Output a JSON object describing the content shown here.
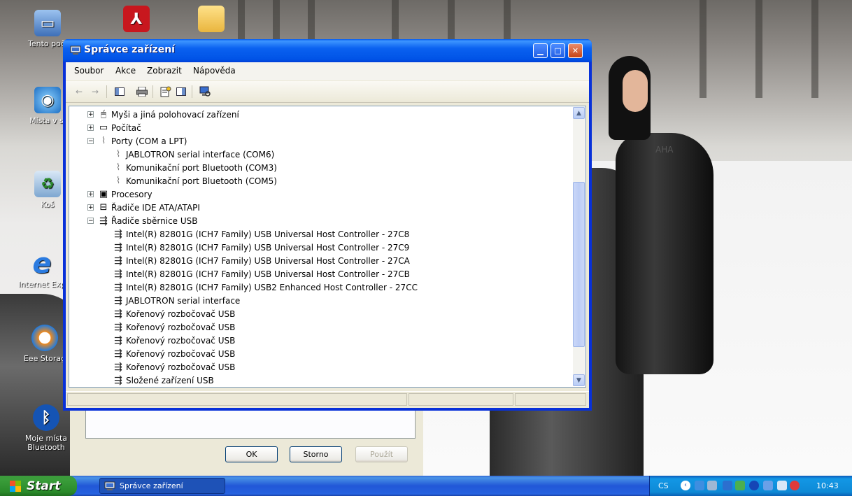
{
  "desktop": {
    "icons": [
      {
        "label": "Tento počí",
        "icon": "my-computer-icon"
      },
      {
        "label": "Místa v sí",
        "icon": "network-places-icon"
      },
      {
        "label": "Koš",
        "icon": "recycle-bin-icon"
      },
      {
        "label": "Internet Exp",
        "icon": "internet-explorer-icon"
      },
      {
        "label": "Eee Storag",
        "icon": "eee-storage-icon"
      },
      {
        "label": "Moje místa Bluetooth",
        "icon": "bluetooth-icon"
      },
      {
        "label": "",
        "icon": "adobe-reader-icon"
      },
      {
        "label": "",
        "icon": "folder-icon"
      }
    ],
    "wall_text": "AHA"
  },
  "back_dialog": {
    "ok_label": "OK",
    "cancel_label": "Storno",
    "apply_label": "Použít"
  },
  "window": {
    "title": "Správce zařízení",
    "menu": [
      "Soubor",
      "Akce",
      "Zobrazit",
      "Nápověda"
    ],
    "toolbar": [
      "back-icon",
      "forward-icon",
      "console-tree-icon",
      "print-icon",
      "properties-icon",
      "help-icon",
      "scan-hardware-icon"
    ],
    "tree": [
      {
        "label": "Myši a jiná polohovací zařízení",
        "level": 0,
        "expander": "+",
        "icon": "mouse-icon"
      },
      {
        "label": "Počítač",
        "level": 0,
        "expander": "+",
        "icon": "computer-icon"
      },
      {
        "label": "Porty (COM a LPT)",
        "level": 0,
        "expander": "−",
        "icon": "port-icon"
      },
      {
        "label": "JABLOTRON serial interface (COM6)",
        "level": 1,
        "expander": "",
        "icon": "port-icon"
      },
      {
        "label": "Komunikační port Bluetooth (COM3)",
        "level": 1,
        "expander": "",
        "icon": "port-icon"
      },
      {
        "label": "Komunikační port Bluetooth (COM5)",
        "level": 1,
        "expander": "",
        "icon": "port-icon"
      },
      {
        "label": "Procesory",
        "level": 0,
        "expander": "+",
        "icon": "processor-icon"
      },
      {
        "label": "Řadiče IDE ATA/ATAPI",
        "level": 0,
        "expander": "+",
        "icon": "ide-controller-icon"
      },
      {
        "label": "Řadiče sběrnice USB",
        "level": 0,
        "expander": "−",
        "icon": "usb-icon"
      },
      {
        "label": "Intel(R) 82801G (ICH7 Family) USB Universal Host Controller - 27C8",
        "level": 1,
        "expander": "",
        "icon": "usb-icon"
      },
      {
        "label": "Intel(R) 82801G (ICH7 Family) USB Universal Host Controller - 27C9",
        "level": 1,
        "expander": "",
        "icon": "usb-icon"
      },
      {
        "label": "Intel(R) 82801G (ICH7 Family) USB Universal Host Controller - 27CA",
        "level": 1,
        "expander": "",
        "icon": "usb-icon"
      },
      {
        "label": "Intel(R) 82801G (ICH7 Family) USB Universal Host Controller - 27CB",
        "level": 1,
        "expander": "",
        "icon": "usb-icon"
      },
      {
        "label": "Intel(R) 82801G (ICH7 Family) USB2 Enhanced Host Controller - 27CC",
        "level": 1,
        "expander": "",
        "icon": "usb-icon"
      },
      {
        "label": "JABLOTRON serial interface",
        "level": 1,
        "expander": "",
        "icon": "usb-icon"
      },
      {
        "label": "Kořenový rozbočovač USB",
        "level": 1,
        "expander": "",
        "icon": "usb-icon"
      },
      {
        "label": "Kořenový rozbočovač USB",
        "level": 1,
        "expander": "",
        "icon": "usb-icon"
      },
      {
        "label": "Kořenový rozbočovač USB",
        "level": 1,
        "expander": "",
        "icon": "usb-icon"
      },
      {
        "label": "Kořenový rozbočovač USB",
        "level": 1,
        "expander": "",
        "icon": "usb-icon"
      },
      {
        "label": "Kořenový rozbočovač USB",
        "level": 1,
        "expander": "",
        "icon": "usb-icon"
      },
      {
        "label": "Složené zařízení USB",
        "level": 1,
        "expander": "",
        "icon": "usb-icon"
      }
    ],
    "scroll_position": 0.25
  },
  "taskbar": {
    "start_label": "Start",
    "task_label": "Správce zařízení",
    "language": "CS",
    "clock": "10:43"
  }
}
